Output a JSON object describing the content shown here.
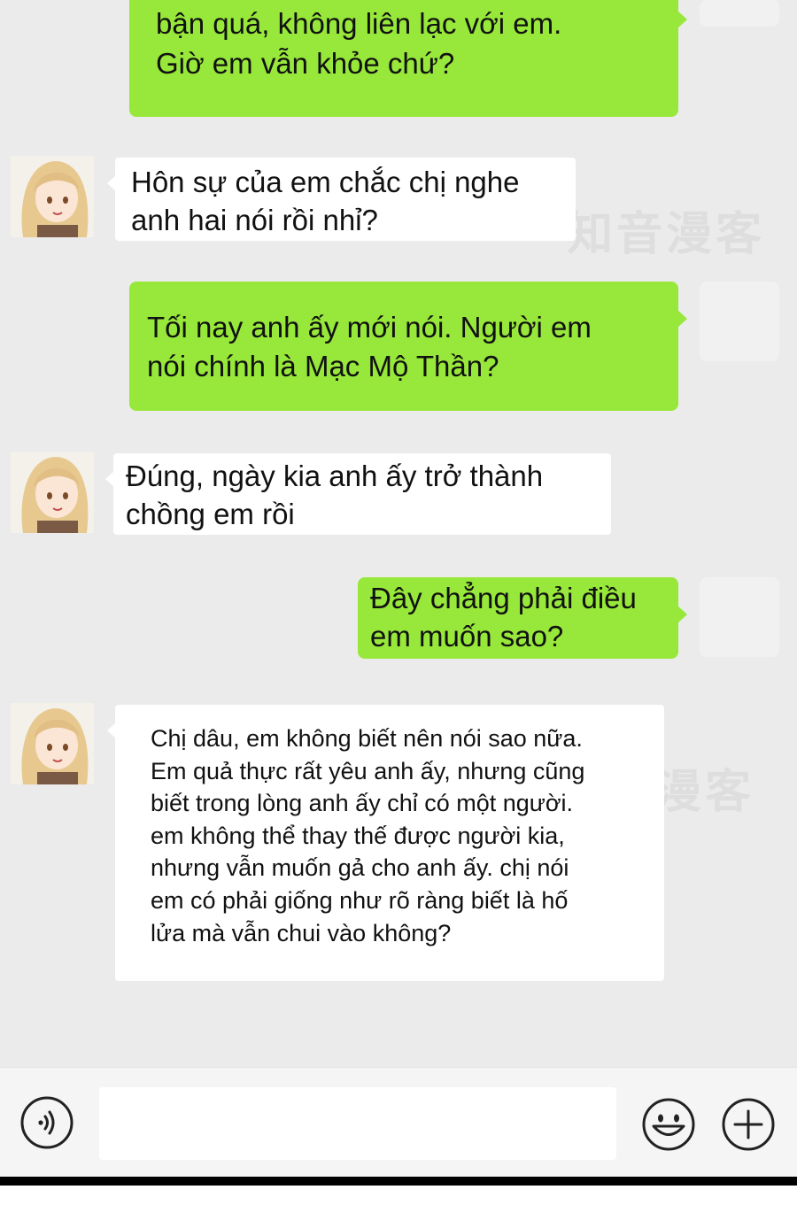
{
  "watermarks": [
    "知音漫客",
    "漫客"
  ],
  "messages": [
    {
      "id": "m1",
      "side": "sent",
      "text": "bận quá, không liên lạc với em.\nGiờ em vẫn khỏe chứ?"
    },
    {
      "id": "m2",
      "side": "received",
      "text": "Hôn sự của em chắc chị nghe\nanh hai nói rồi nhỉ?"
    },
    {
      "id": "m3",
      "side": "sent",
      "text": "Tối nay anh ấy mới nói. Người em\nnói chính là Mạc Mộ Thần?"
    },
    {
      "id": "m4",
      "side": "received",
      "text": "Đúng, ngày kia anh ấy trở thành\nchồng em rồi"
    },
    {
      "id": "m5",
      "side": "sent",
      "text": "Đây chẳng phải điều\nem muốn sao?"
    },
    {
      "id": "m6",
      "side": "received",
      "text": "Chị dâu, em không biết nên nói sao nữa.\nEm quả thực rất yêu anh ấy, nhưng cũng\nbiết trong lòng anh ấy chỉ có một người.\nem không thể thay thế được người kia,\nnhưng vẫn muốn gả cho anh ấy. chị nói\nem có phải giống như rõ ràng biết là hố\nlửa mà vẫn chui vào không?"
    }
  ],
  "input_bar": {
    "voice_icon": "voice-icon",
    "emoji_icon": "smiley-icon",
    "add_icon": "plus-icon",
    "text_value": ""
  },
  "colors": {
    "sent_bubble": "#97e83a",
    "received_bubble": "#ffffff",
    "background": "#ebebeb"
  }
}
